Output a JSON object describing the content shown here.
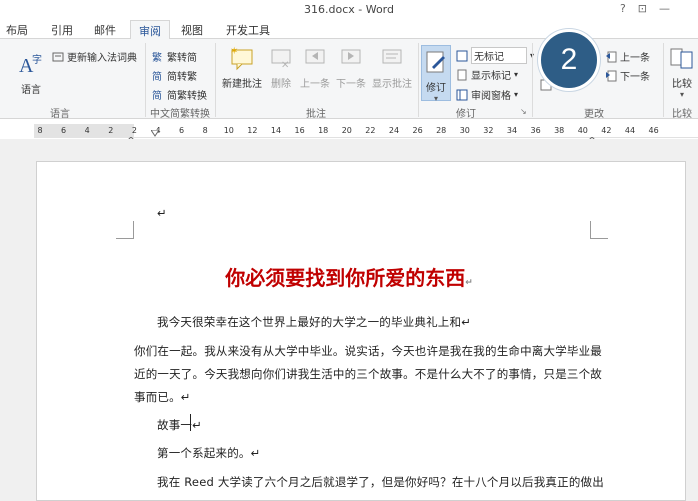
{
  "window": {
    "title": "316.docx - Word"
  },
  "tabs": [
    {
      "label": "布局"
    },
    {
      "label": "引用"
    },
    {
      "label": "邮件"
    },
    {
      "label": "审阅"
    },
    {
      "label": "视图"
    },
    {
      "label": "开发工具"
    }
  ],
  "active_tab": "审阅",
  "ribbon": {
    "language_group": {
      "big_button": "语言",
      "update_ime": "更新输入法词典",
      "label": "语言"
    },
    "chinese_conversion": {
      "to_simplified": "繁转简",
      "to_traditional": "简转繁",
      "convert": "简繁转换",
      "label": "中文简繁转换"
    },
    "comments": {
      "new_comment": "新建批注",
      "delete": "删除",
      "previous": "上一条",
      "next": "下一条",
      "show_comments": "显示批注",
      "label": "批注"
    },
    "tracking": {
      "track_changes": "修订",
      "markup_select": "无标记",
      "show_markup": "显示标记",
      "reviewing_pane": "审阅窗格",
      "label": "修订"
    },
    "changes": {
      "previous": "上一条",
      "next": "下一条",
      "label": "更改"
    },
    "compare": {
      "compare_btn": "比较",
      "label": "比较"
    }
  },
  "ruler_ticks": [
    "8",
    "6",
    "4",
    "2",
    "2",
    "4",
    "6",
    "8",
    "10",
    "12",
    "14",
    "16",
    "18",
    "20",
    "22",
    "24",
    "26",
    "28",
    "30",
    "32",
    "34",
    "36",
    "38",
    "40",
    "42",
    "44",
    "46"
  ],
  "badge": {
    "number": "2"
  },
  "document": {
    "empty_mark": "↵",
    "title": "你必须要找到你所爱的东西",
    "title_mark": "↵",
    "paragraphs": [
      "我今天很荣幸在这个世界上最好的大学之一的毕业典礼上和↵",
      "你们在一起。我从来没有从大学中毕业。说实话，今天也许是我在我的生命中离大学毕业最",
      "近的一天了。今天我想向你们讲我生活中的三个故事。不是什么大不了的事情，只是三个故",
      "事而已。↵",
      "故事一↵",
      "第一个系起来的。↵",
      "我在 Reed 大学读了六个月之后就退学了，但是你好吗？在十八个月以后我真正的做出"
    ]
  },
  "colors": {
    "accent": "#2b579a",
    "title_red": "#c00000",
    "badge": "#2e5d86"
  }
}
